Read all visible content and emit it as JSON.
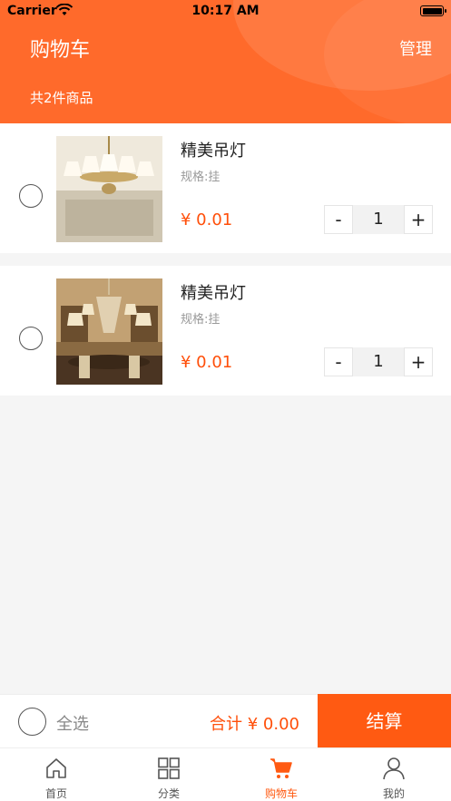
{
  "status_bar": {
    "carrier": "Carrier",
    "time": "10:17 AM"
  },
  "header": {
    "title": "购物车",
    "manage_label": "管理",
    "count_text": "共2件商品"
  },
  "items": [
    {
      "name": "精美吊灯",
      "spec": "规格:挂",
      "price": "¥ 0.01",
      "quantity": "1",
      "minus": "-",
      "plus": "+"
    },
    {
      "name": "精美吊灯",
      "spec": "规格:挂",
      "price": "¥ 0.01",
      "quantity": "1",
      "minus": "-",
      "plus": "+"
    }
  ],
  "bottom_bar": {
    "select_all": "全选",
    "total": "合计 ¥ 0.00",
    "checkout": "结算"
  },
  "tabs": [
    {
      "label": "首页",
      "icon": "home-icon"
    },
    {
      "label": "分类",
      "icon": "grid-icon"
    },
    {
      "label": "购物车",
      "icon": "cart-icon"
    },
    {
      "label": "我的",
      "icon": "user-icon"
    }
  ],
  "colors": {
    "accent": "#ff5a12",
    "header": "#ff6a2b",
    "price": "#ff4f0a"
  }
}
